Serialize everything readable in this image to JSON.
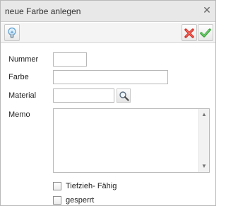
{
  "window": {
    "title": "neue Farbe anlegen",
    "close_symbol": "✕"
  },
  "toolbar": {
    "hint_icon": "lightbulb-icon",
    "cancel_icon": "red-x-icon",
    "confirm_icon": "green-check-icon",
    "colors": {
      "cancel": "#d9332a",
      "confirm": "#3aa63a",
      "bulb": "#6fb1e0"
    }
  },
  "form": {
    "nummer": {
      "label": "Nummer",
      "value": ""
    },
    "farbe": {
      "label": "Farbe",
      "value": ""
    },
    "material": {
      "label": "Material",
      "value": "",
      "lookup_icon": "magnifier-icon"
    },
    "memo": {
      "label": "Memo",
      "value": ""
    },
    "tiefzieh": {
      "label": "Tiefzieh- Fähig",
      "checked": false
    },
    "gesperrt": {
      "label": "gesperrt",
      "checked": false
    }
  }
}
